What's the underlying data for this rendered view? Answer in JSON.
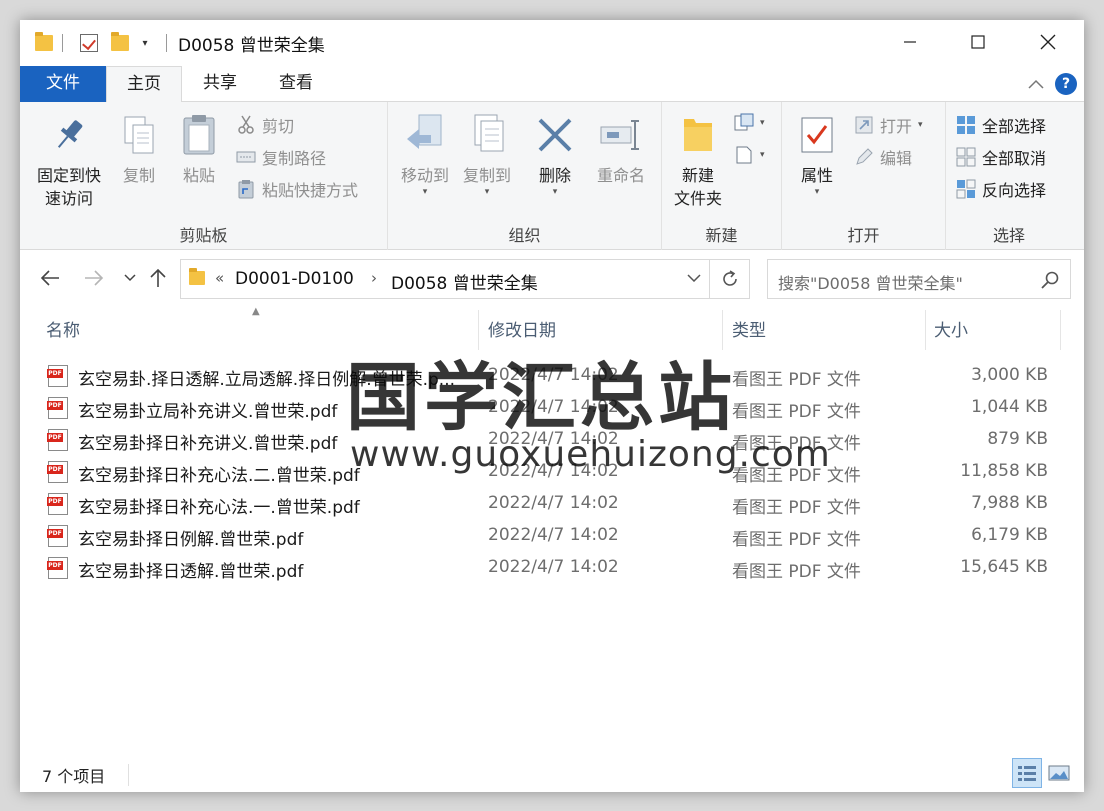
{
  "window": {
    "title": "D0058 曾世荣全集",
    "quick_access": [
      "folder-icon",
      "properties-check-icon",
      "new-folder-icon",
      "customize-dropdown"
    ]
  },
  "tabs": [
    {
      "label": "文件"
    },
    {
      "label": "主页"
    },
    {
      "label": "共享"
    },
    {
      "label": "查看"
    }
  ],
  "ribbon": {
    "clipboard": {
      "label": "剪贴板",
      "pin_line1": "固定到快",
      "pin_line2": "速访问",
      "copy": "复制",
      "paste": "粘贴",
      "cut": "剪切",
      "copy_path": "复制路径",
      "paste_shortcut": "粘贴快捷方式"
    },
    "organize": {
      "label": "组织",
      "move_to": "移动到",
      "copy_to": "复制到",
      "delete": "删除",
      "rename": "重命名"
    },
    "new": {
      "label": "新建",
      "new_folder_line1": "新建",
      "new_folder_line2": "文件夹"
    },
    "open": {
      "label": "打开",
      "properties": "属性",
      "open": "打开",
      "edit": "编辑"
    },
    "select": {
      "label": "选择",
      "select_all": "全部选择",
      "select_none": "全部取消",
      "invert": "反向选择"
    }
  },
  "address": {
    "overflow": "«",
    "crumbs": [
      "D0001-D0100",
      "D0058 曾世荣全集"
    ],
    "search_placeholder": "搜索\"D0058 曾世荣全集\""
  },
  "columns": {
    "name": "名称",
    "date": "修改日期",
    "type": "类型",
    "size": "大小"
  },
  "files": [
    {
      "name": "玄空易卦.择日透解.立局透解.择日例解.曾世荣.p...",
      "date": "2022/4/7 14:02",
      "type": "看图王 PDF 文件",
      "size": "3,000 KB"
    },
    {
      "name": "玄空易卦立局补充讲义.曾世荣.pdf",
      "date": "2022/4/7 14:02",
      "type": "看图王 PDF 文件",
      "size": "1,044 KB"
    },
    {
      "name": "玄空易卦择日补充讲义.曾世荣.pdf",
      "date": "2022/4/7 14:02",
      "type": "看图王 PDF 文件",
      "size": "879 KB"
    },
    {
      "name": "玄空易卦择日补充心法.二.曾世荣.pdf",
      "date": "2022/4/7 14:02",
      "type": "看图王 PDF 文件",
      "size": "11,858 KB"
    },
    {
      "name": "玄空易卦择日补充心法.一.曾世荣.pdf",
      "date": "2022/4/7 14:02",
      "type": "看图王 PDF 文件",
      "size": "7,988 KB"
    },
    {
      "name": "玄空易卦择日例解.曾世荣.pdf",
      "date": "2022/4/7 14:02",
      "type": "看图王 PDF 文件",
      "size": "6,179 KB"
    },
    {
      "name": "玄空易卦择日透解.曾世荣.pdf",
      "date": "2022/4/7 14:02",
      "type": "看图王 PDF 文件",
      "size": "15,645 KB"
    }
  ],
  "watermark": {
    "line1": "国学汇总站",
    "line2": "www.guoxuehuizong.com"
  },
  "status": {
    "count": "7 个项目"
  },
  "file_icon_label": "PDF",
  "colors": {
    "accent": "#1a63c0",
    "pdf_red": "#d9261c",
    "folder": "#f4c243"
  }
}
